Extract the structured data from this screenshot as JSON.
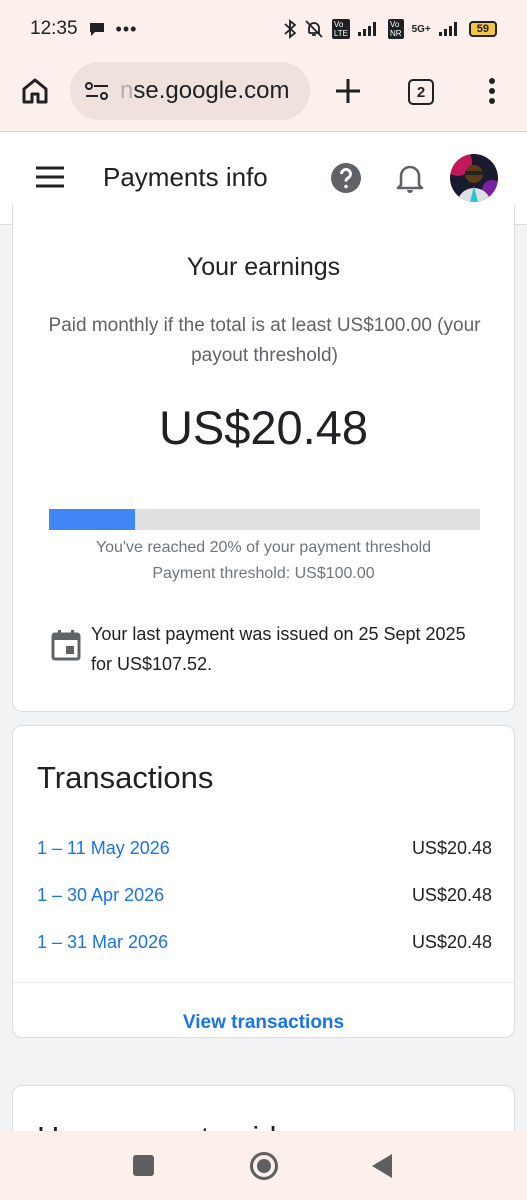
{
  "status_bar": {
    "time": "12:35",
    "dots": "•••",
    "network": "5G+",
    "battery": "59"
  },
  "browser": {
    "url_faded": "n",
    "url_main": "se.google.com",
    "tab_count": "2"
  },
  "header": {
    "title": "Payments info"
  },
  "earnings": {
    "title": "Your earnings",
    "subtitle": "Paid monthly if the total is at least US$100.00 (your payout threshold)",
    "amount": "US$20.48",
    "progress_fraction": 0.2,
    "progress_text": "You've reached 20% of your payment threshold",
    "threshold_text": "Payment threshold: US$100.00",
    "last_payment": "Your last payment was issued on 25 Sept 2025 for US$107.52."
  },
  "transactions": {
    "title": "Transactions",
    "rows": [
      {
        "period": "1 – 11 May 2026",
        "amount": "US$20.48"
      },
      {
        "period": "1 – 30 Apr 2026",
        "amount": "US$20.48"
      },
      {
        "period": "1 – 31 Mar 2026",
        "amount": "US$20.48"
      }
    ],
    "view_label": "View transactions"
  },
  "next_card": {
    "title": "How you get paid"
  },
  "colors": {
    "accent": "#1a73e8",
    "progress": "#4285f4",
    "chrome_bg": "#fbf0eb"
  }
}
